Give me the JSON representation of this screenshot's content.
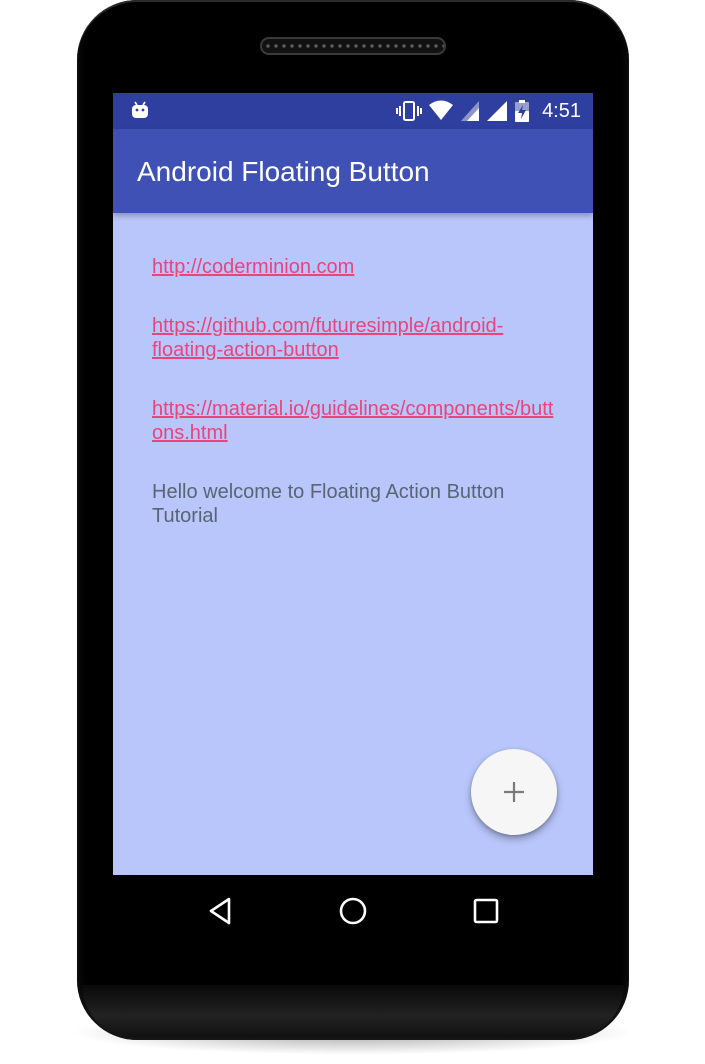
{
  "status_bar": {
    "time": "4:51",
    "icons": [
      "android-debug-icon",
      "vibrate-icon",
      "wifi-icon",
      "signal-icon",
      "signal-full-icon",
      "battery-charging-icon"
    ]
  },
  "app_bar": {
    "title": "Android Floating Button"
  },
  "content": {
    "links": [
      {
        "text": "http://coderminion.com"
      },
      {
        "text": "https://github.com/futuresimple/android-floating-action-button"
      },
      {
        "text": "https://material.io/guidelines/components/buttons.html"
      }
    ],
    "message": "Hello welcome to Floating Action Button Tutorial"
  },
  "fab": {
    "icon": "plus-icon"
  },
  "nav_bar": {
    "buttons": [
      "back-icon",
      "home-icon",
      "recents-icon"
    ]
  },
  "colors": {
    "status_bar": "#2f3f9f",
    "app_bar": "#3f51b5",
    "background": "#b8c6fb",
    "link": "#e8457c",
    "text": "#5a6474",
    "fab": "#f6f6f6"
  }
}
